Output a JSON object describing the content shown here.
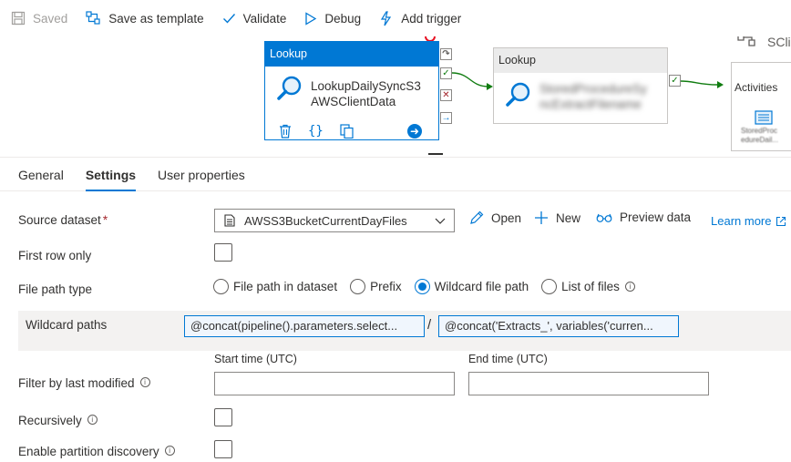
{
  "toolbar": {
    "saved_label": "Saved",
    "save_template_label": "Save as template",
    "validate_label": "Validate",
    "debug_label": "Debug",
    "add_trigger_label": "Add trigger"
  },
  "canvas": {
    "activity1": {
      "type_label": "Lookup",
      "name_line1": "LookupDailySyncS3",
      "name_line2": "AWSClientData"
    },
    "activity2": {
      "type_label": "Lookup",
      "name_line1": "StoredProcedureSy",
      "name_line2": "ncExtractFilename"
    },
    "activity3": {
      "header_fragment": "SCli",
      "label": "Activities",
      "sub_line1": "StoredProc",
      "sub_line2": "edureDail..."
    }
  },
  "tabs": [
    {
      "label": "General"
    },
    {
      "label": "Settings"
    },
    {
      "label": "User properties"
    }
  ],
  "form": {
    "source_dataset_label": "Source dataset",
    "required_mark": "*",
    "source_dataset_value": "AWSS3BucketCurrentDayFiles",
    "open_label": "Open",
    "new_label": "New",
    "preview_label": "Preview data",
    "learn_more_label": "Learn more",
    "first_row_label": "First row only",
    "file_path_type_label": "File path type",
    "radio_options": [
      "File path in dataset",
      "Prefix",
      "Wildcard file path",
      "List of files"
    ],
    "selected_option": "Wildcard file path",
    "wildcard_label": "Wildcard paths",
    "wildcard_folder": "@concat(pipeline().parameters.select...",
    "wildcard_separator": "/",
    "wildcard_file": "@concat('Extracts_', variables('curren...",
    "start_time_label": "Start time (UTC)",
    "end_time_label": "End time (UTC)",
    "filter_label": "Filter by last modified",
    "recursively_label": "Recursively",
    "partition_label": "Enable partition discovery"
  },
  "colors": {
    "accent": "#0078d4",
    "success": "#107c10",
    "error": "#a4262c"
  }
}
